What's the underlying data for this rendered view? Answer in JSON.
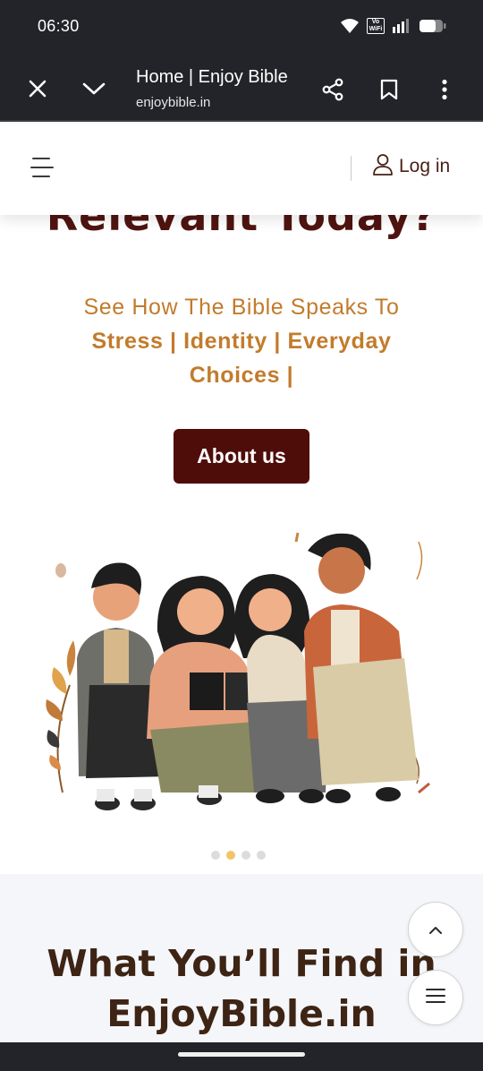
{
  "status": {
    "time": "06:30",
    "vowifi_label": "Vo\nWiFi",
    "icons": [
      "wifi-icon",
      "vowifi-icon",
      "signal-icon",
      "battery-icon"
    ]
  },
  "browser": {
    "title": "Home | Enjoy Bible",
    "url": "enjoybible.in",
    "icons": [
      "close-icon",
      "chevron-down-icon",
      "share-icon",
      "bookmark-icon",
      "more-vert-icon"
    ]
  },
  "header": {
    "menu_icon": "menu-icon",
    "login_icon": "user-icon",
    "login_label": "Log in"
  },
  "hero": {
    "heading": "Relevant Today?",
    "sub_intro": "See How The Bible Speaks To",
    "sub_bold_1": "Stress | Identity | Everyday",
    "sub_bold_2": "Choices |",
    "button_label": "About us",
    "illustration": "four-young-people-reading-bible-illustration"
  },
  "carousel": {
    "count": 4,
    "active_index": 1
  },
  "section": {
    "title_line1": "What You’ll Find in",
    "title_line2": "EnjoyBible.in"
  },
  "fabs": [
    "scroll-to-top-icon",
    "menu-icon"
  ],
  "colors": {
    "brand_dark": "#4f0d0a",
    "heading": "#4f1410",
    "accent": "#c27b2c",
    "section_title": "#3e2414",
    "section_bg": "#f4f6f9",
    "system_bar": "#232429",
    "active_dot": "#f2c46a"
  }
}
